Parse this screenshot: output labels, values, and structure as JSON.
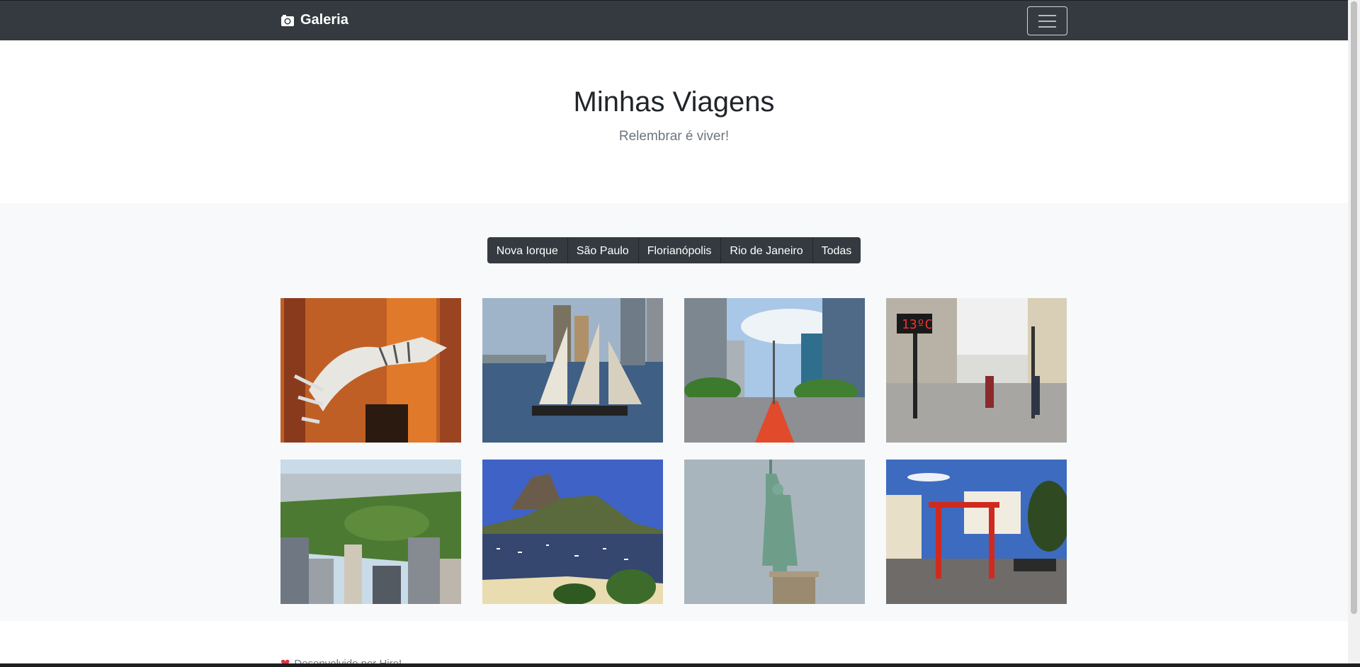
{
  "navbar": {
    "brand": "Galeria",
    "toggler_label": "menu"
  },
  "hero": {
    "title": "Minhas Viagens",
    "subtitle": "Relembrar é viver!"
  },
  "filters": [
    "Nova Iorque",
    "São Paulo",
    "Florianópolis",
    "Rio de Janeiro",
    "Todas"
  ],
  "photos": [
    {
      "name": "dinosaur-skeleton-photo"
    },
    {
      "name": "sailboat-photo"
    },
    {
      "name": "avenue-bike-lane-photo"
    },
    {
      "name": "street-thermometer-photo"
    },
    {
      "name": "central-park-photo"
    },
    {
      "name": "sugarloaf-mountain-photo"
    },
    {
      "name": "statue-of-liberty-photo"
    },
    {
      "name": "red-torii-street-photo"
    }
  ],
  "footer": {
    "text": "Desenvolvido por Hiro!"
  }
}
